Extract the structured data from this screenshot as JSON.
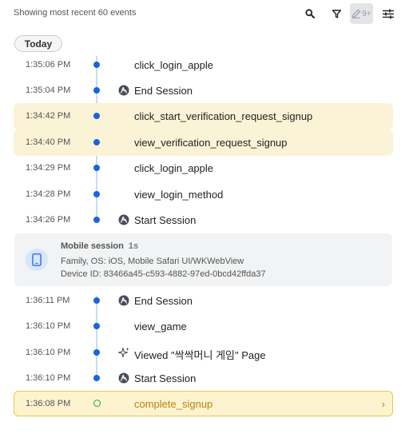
{
  "header": {
    "summary": "Showing most recent 60 events",
    "edit_count": "9+",
    "icons": [
      "search-icon",
      "filter-icon",
      "edit-icon",
      "settings-sliders-icon"
    ]
  },
  "today_label": "Today",
  "events_group1": [
    {
      "time": "1:35:06 PM",
      "name": "click_login_apple",
      "icon": "",
      "highlight": false
    },
    {
      "time": "1:35:04 PM",
      "name": "End Session",
      "icon": "session-icon",
      "highlight": false
    },
    {
      "time": "1:34:42 PM",
      "name": "click_start_verification_request_signup",
      "icon": "",
      "highlight": true
    },
    {
      "time": "1:34:40 PM",
      "name": "view_verification_request_signup",
      "icon": "",
      "highlight": true
    },
    {
      "time": "1:34:29 PM",
      "name": "click_login_apple",
      "icon": "",
      "highlight": false
    },
    {
      "time": "1:34:28 PM",
      "name": "view_login_method",
      "icon": "",
      "highlight": false
    },
    {
      "time": "1:34:26 PM",
      "name": "Start Session",
      "icon": "session-icon",
      "highlight": false
    }
  ],
  "session": {
    "title": "Mobile session",
    "duration": "1s",
    "platform": "Family, OS: iOS, Mobile Safari UI/WKWebView",
    "device": "Device ID: 83466a45-c593-4882-97ed-0bcd42ffda37"
  },
  "events_group2": [
    {
      "time": "1:36:11 PM",
      "name": "End Session",
      "icon": "session-icon"
    },
    {
      "time": "1:36:10 PM",
      "name": "view_game",
      "icon": ""
    },
    {
      "time": "1:36:10 PM",
      "name": "Viewed \"싹싹머니 게임\" Page",
      "icon": "sparkle-icon"
    },
    {
      "time": "1:36:10 PM",
      "name": "Start Session",
      "icon": "session-icon"
    }
  ],
  "selected_event": {
    "time": "1:36:08 PM",
    "name": "complete_signup"
  },
  "colors": {
    "accent": "#1a63e0",
    "highlight_bg": "#fbf3d6",
    "selected_border": "#e9c84a",
    "selected_text": "#b8860b",
    "hollow_dot": "#2a9d5b"
  }
}
